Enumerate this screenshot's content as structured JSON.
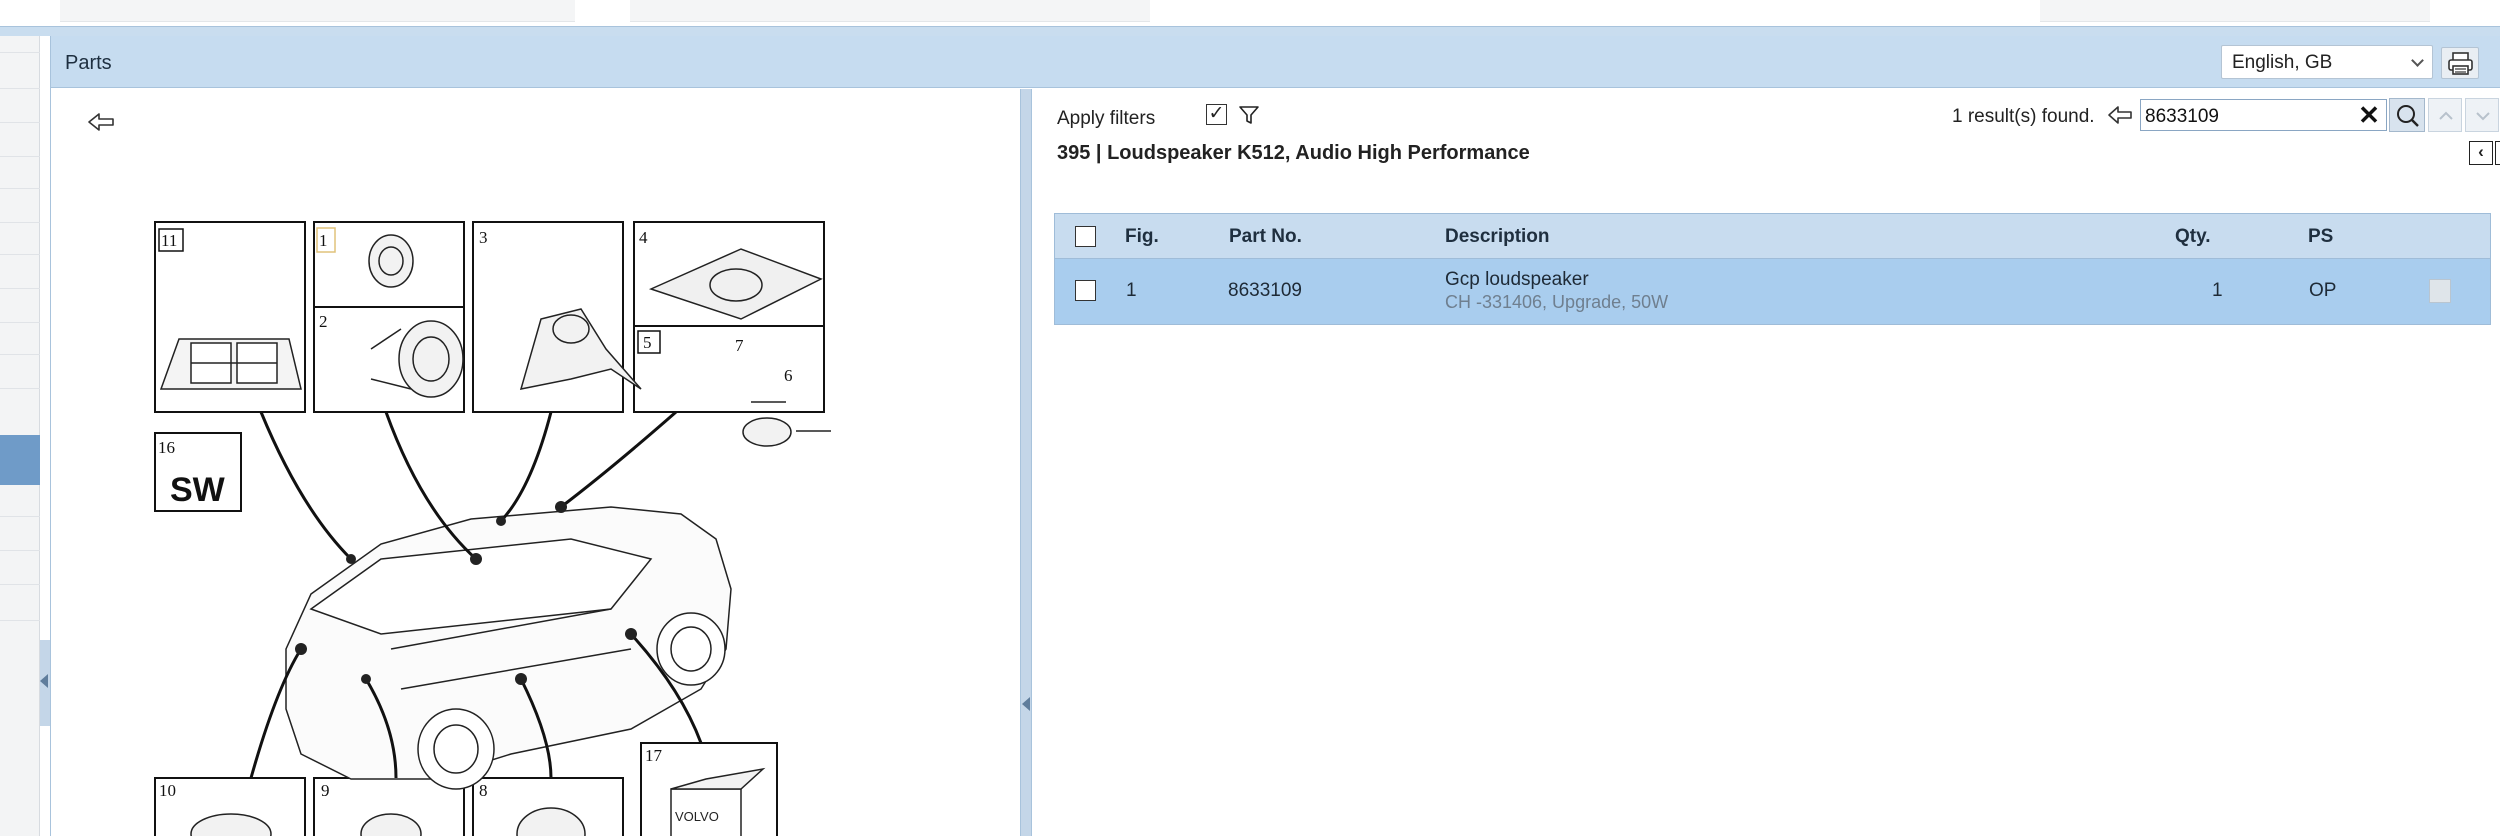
{
  "panel": {
    "title": "Parts"
  },
  "language": {
    "selected": "English, GB"
  },
  "filters": {
    "label": "Apply filters",
    "checked_mark": "✓"
  },
  "search": {
    "result_text": "1 result(s) found.",
    "query": "8633109",
    "clear_glyph": "✕"
  },
  "section": {
    "title": "395  |  Loudspeaker K512, Audio High Performance"
  },
  "pager": {
    "prev": "‹",
    "next": "›"
  },
  "table": {
    "headers": {
      "fig": "Fig.",
      "part_no": "Part No.",
      "description": "Description",
      "qty": "Qty.",
      "ps": "PS"
    },
    "rows": [
      {
        "fig": "1",
        "part_no": "8633109",
        "description": "Gcp loudspeaker",
        "description_sub": "CH -331406, Upgrade, 50W",
        "qty": "1",
        "ps": "OP"
      }
    ]
  },
  "diagram": {
    "callouts": [
      "11",
      "1",
      "2",
      "3",
      "4",
      "5",
      "7",
      "6",
      "16",
      "10",
      "9",
      "8",
      "17"
    ],
    "sw_label": "SW",
    "box_brand": "VOLVO"
  },
  "icons": [
    "back-arrow-icon",
    "funnel-icon",
    "search-icon",
    "chevron-up-icon",
    "chevron-down-icon",
    "printer-icon",
    "clear-icon"
  ],
  "colors": {
    "header_bg": "#c6dcf0",
    "row_selected": "#a9cdee",
    "rail_active": "#6f9bc8"
  }
}
